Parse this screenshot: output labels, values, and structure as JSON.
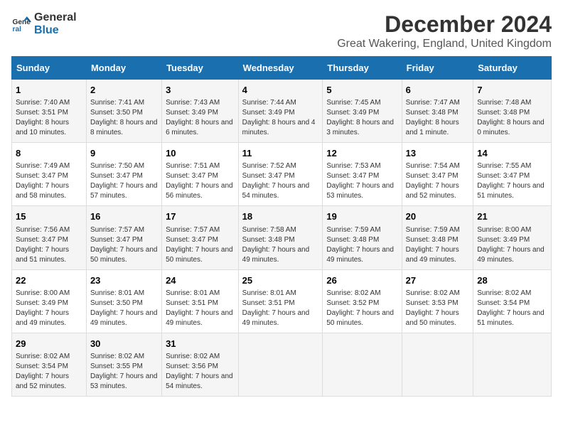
{
  "logo": {
    "line1": "General",
    "line2": "Blue"
  },
  "title": "December 2024",
  "subtitle": "Great Wakering, England, United Kingdom",
  "days_header": [
    "Sunday",
    "Monday",
    "Tuesday",
    "Wednesday",
    "Thursday",
    "Friday",
    "Saturday"
  ],
  "weeks": [
    [
      {
        "day": "1",
        "sunrise": "Sunrise: 7:40 AM",
        "sunset": "Sunset: 3:51 PM",
        "daylight": "Daylight: 8 hours and 10 minutes."
      },
      {
        "day": "2",
        "sunrise": "Sunrise: 7:41 AM",
        "sunset": "Sunset: 3:50 PM",
        "daylight": "Daylight: 8 hours and 8 minutes."
      },
      {
        "day": "3",
        "sunrise": "Sunrise: 7:43 AM",
        "sunset": "Sunset: 3:49 PM",
        "daylight": "Daylight: 8 hours and 6 minutes."
      },
      {
        "day": "4",
        "sunrise": "Sunrise: 7:44 AM",
        "sunset": "Sunset: 3:49 PM",
        "daylight": "Daylight: 8 hours and 4 minutes."
      },
      {
        "day": "5",
        "sunrise": "Sunrise: 7:45 AM",
        "sunset": "Sunset: 3:49 PM",
        "daylight": "Daylight: 8 hours and 3 minutes."
      },
      {
        "day": "6",
        "sunrise": "Sunrise: 7:47 AM",
        "sunset": "Sunset: 3:48 PM",
        "daylight": "Daylight: 8 hours and 1 minute."
      },
      {
        "day": "7",
        "sunrise": "Sunrise: 7:48 AM",
        "sunset": "Sunset: 3:48 PM",
        "daylight": "Daylight: 8 hours and 0 minutes."
      }
    ],
    [
      {
        "day": "8",
        "sunrise": "Sunrise: 7:49 AM",
        "sunset": "Sunset: 3:47 PM",
        "daylight": "Daylight: 7 hours and 58 minutes."
      },
      {
        "day": "9",
        "sunrise": "Sunrise: 7:50 AM",
        "sunset": "Sunset: 3:47 PM",
        "daylight": "Daylight: 7 hours and 57 minutes."
      },
      {
        "day": "10",
        "sunrise": "Sunrise: 7:51 AM",
        "sunset": "Sunset: 3:47 PM",
        "daylight": "Daylight: 7 hours and 56 minutes."
      },
      {
        "day": "11",
        "sunrise": "Sunrise: 7:52 AM",
        "sunset": "Sunset: 3:47 PM",
        "daylight": "Daylight: 7 hours and 54 minutes."
      },
      {
        "day": "12",
        "sunrise": "Sunrise: 7:53 AM",
        "sunset": "Sunset: 3:47 PM",
        "daylight": "Daylight: 7 hours and 53 minutes."
      },
      {
        "day": "13",
        "sunrise": "Sunrise: 7:54 AM",
        "sunset": "Sunset: 3:47 PM",
        "daylight": "Daylight: 7 hours and 52 minutes."
      },
      {
        "day": "14",
        "sunrise": "Sunrise: 7:55 AM",
        "sunset": "Sunset: 3:47 PM",
        "daylight": "Daylight: 7 hours and 51 minutes."
      }
    ],
    [
      {
        "day": "15",
        "sunrise": "Sunrise: 7:56 AM",
        "sunset": "Sunset: 3:47 PM",
        "daylight": "Daylight: 7 hours and 51 minutes."
      },
      {
        "day": "16",
        "sunrise": "Sunrise: 7:57 AM",
        "sunset": "Sunset: 3:47 PM",
        "daylight": "Daylight: 7 hours and 50 minutes."
      },
      {
        "day": "17",
        "sunrise": "Sunrise: 7:57 AM",
        "sunset": "Sunset: 3:47 PM",
        "daylight": "Daylight: 7 hours and 50 minutes."
      },
      {
        "day": "18",
        "sunrise": "Sunrise: 7:58 AM",
        "sunset": "Sunset: 3:48 PM",
        "daylight": "Daylight: 7 hours and 49 minutes."
      },
      {
        "day": "19",
        "sunrise": "Sunrise: 7:59 AM",
        "sunset": "Sunset: 3:48 PM",
        "daylight": "Daylight: 7 hours and 49 minutes."
      },
      {
        "day": "20",
        "sunrise": "Sunrise: 7:59 AM",
        "sunset": "Sunset: 3:48 PM",
        "daylight": "Daylight: 7 hours and 49 minutes."
      },
      {
        "day": "21",
        "sunrise": "Sunrise: 8:00 AM",
        "sunset": "Sunset: 3:49 PM",
        "daylight": "Daylight: 7 hours and 49 minutes."
      }
    ],
    [
      {
        "day": "22",
        "sunrise": "Sunrise: 8:00 AM",
        "sunset": "Sunset: 3:49 PM",
        "daylight": "Daylight: 7 hours and 49 minutes."
      },
      {
        "day": "23",
        "sunrise": "Sunrise: 8:01 AM",
        "sunset": "Sunset: 3:50 PM",
        "daylight": "Daylight: 7 hours and 49 minutes."
      },
      {
        "day": "24",
        "sunrise": "Sunrise: 8:01 AM",
        "sunset": "Sunset: 3:51 PM",
        "daylight": "Daylight: 7 hours and 49 minutes."
      },
      {
        "day": "25",
        "sunrise": "Sunrise: 8:01 AM",
        "sunset": "Sunset: 3:51 PM",
        "daylight": "Daylight: 7 hours and 49 minutes."
      },
      {
        "day": "26",
        "sunrise": "Sunrise: 8:02 AM",
        "sunset": "Sunset: 3:52 PM",
        "daylight": "Daylight: 7 hours and 50 minutes."
      },
      {
        "day": "27",
        "sunrise": "Sunrise: 8:02 AM",
        "sunset": "Sunset: 3:53 PM",
        "daylight": "Daylight: 7 hours and 50 minutes."
      },
      {
        "day": "28",
        "sunrise": "Sunrise: 8:02 AM",
        "sunset": "Sunset: 3:54 PM",
        "daylight": "Daylight: 7 hours and 51 minutes."
      }
    ],
    [
      {
        "day": "29",
        "sunrise": "Sunrise: 8:02 AM",
        "sunset": "Sunset: 3:54 PM",
        "daylight": "Daylight: 7 hours and 52 minutes."
      },
      {
        "day": "30",
        "sunrise": "Sunrise: 8:02 AM",
        "sunset": "Sunset: 3:55 PM",
        "daylight": "Daylight: 7 hours and 53 minutes."
      },
      {
        "day": "31",
        "sunrise": "Sunrise: 8:02 AM",
        "sunset": "Sunset: 3:56 PM",
        "daylight": "Daylight: 7 hours and 54 minutes."
      },
      null,
      null,
      null,
      null
    ]
  ]
}
